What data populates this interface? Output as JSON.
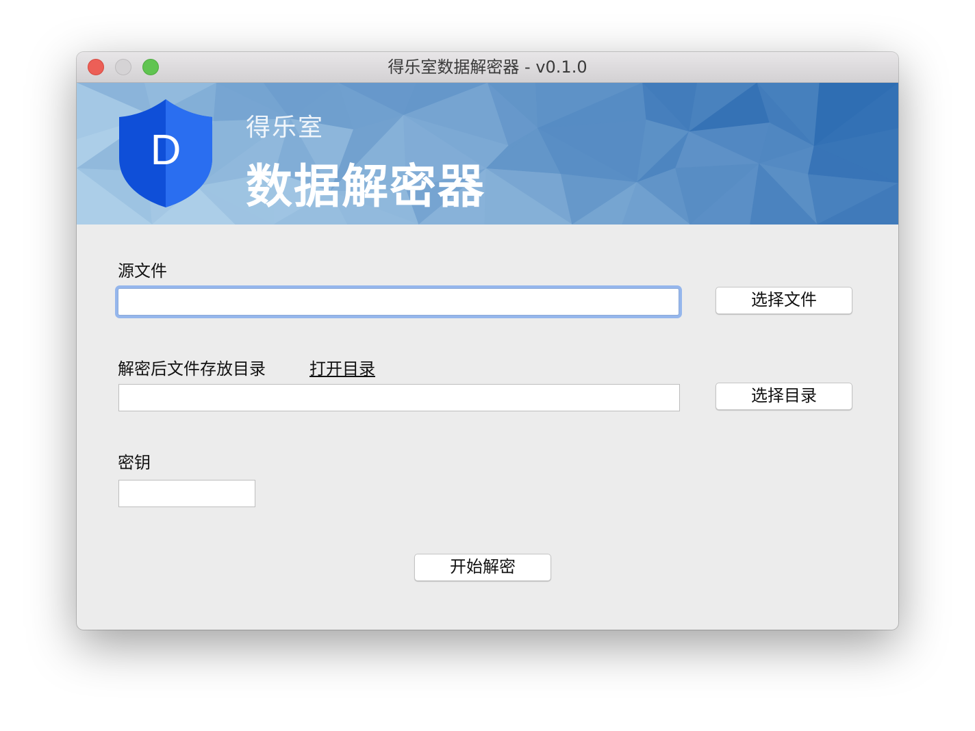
{
  "window": {
    "title": "得乐室数据解密器 - v0.1.0"
  },
  "banner": {
    "logo_letter": "D",
    "subtitle": "得乐室",
    "title": "数据解密器",
    "colors": {
      "banner_light": "#a8cde8",
      "banner_dark": "#2a6db3",
      "shield_blue": "#1c5fe6"
    }
  },
  "form": {
    "source": {
      "label": "源文件",
      "value": "",
      "button_label": "选择文件"
    },
    "output": {
      "label": "解密后文件存放目录",
      "open_link": "打开目录",
      "value": "",
      "button_label": "选择目录"
    },
    "key": {
      "label": "密钥",
      "value": ""
    },
    "start_button_label": "开始解密"
  }
}
